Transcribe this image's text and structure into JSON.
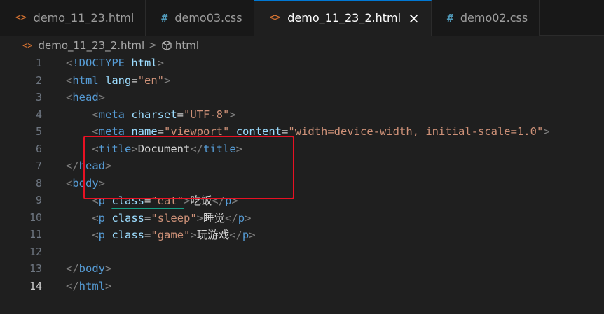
{
  "tabs": [
    {
      "label": "demo_11_23.html",
      "icon": "html-file-icon",
      "glyph": "<>",
      "active": false
    },
    {
      "label": "demo03.css",
      "icon": "css-file-icon",
      "glyph": "#",
      "active": false
    },
    {
      "label": "demo_11_23_2.html",
      "icon": "html-file-icon",
      "glyph": "<>",
      "active": true,
      "close": "×"
    },
    {
      "label": "demo02.css",
      "icon": "css-file-icon",
      "glyph": "#",
      "active": false
    }
  ],
  "breadcrumb": {
    "file_glyph": "<>",
    "file": "demo_11_23_2.html",
    "separator": ">",
    "symbol": "html"
  },
  "colors": {
    "accent": "#0078d4",
    "highlight_box": "#e81123",
    "tag": "#569cd6",
    "attribute": "#9cdcfe",
    "string": "#ce9178"
  },
  "editor": {
    "current_line": 14,
    "lines": [
      {
        "n": "1",
        "tokens": [
          [
            "br",
            "<"
          ],
          [
            "tag",
            "!DOCTYPE"
          ],
          [
            "txt",
            " "
          ],
          [
            "attr",
            "html"
          ],
          [
            "br",
            ">"
          ]
        ]
      },
      {
        "n": "2",
        "tokens": [
          [
            "br",
            "<"
          ],
          [
            "tag",
            "html"
          ],
          [
            "txt",
            " "
          ],
          [
            "attr",
            "lang"
          ],
          [
            "eq",
            "="
          ],
          [
            "str",
            "\"en\""
          ],
          [
            "br",
            ">"
          ]
        ]
      },
      {
        "n": "3",
        "tokens": [
          [
            "br",
            "<"
          ],
          [
            "tag",
            "head"
          ],
          [
            "br",
            ">"
          ]
        ]
      },
      {
        "n": "4",
        "tokens": [
          [
            "txt",
            "    "
          ],
          [
            "br",
            "<"
          ],
          [
            "tag",
            "meta"
          ],
          [
            "txt",
            " "
          ],
          [
            "attr",
            "charset"
          ],
          [
            "eq",
            "="
          ],
          [
            "str",
            "\"UTF-8\""
          ],
          [
            "br",
            ">"
          ]
        ]
      },
      {
        "n": "5",
        "tokens": [
          [
            "txt",
            "    "
          ],
          [
            "br",
            "<"
          ],
          [
            "tag",
            "meta"
          ],
          [
            "txt",
            " "
          ],
          [
            "attr",
            "name"
          ],
          [
            "eq",
            "="
          ],
          [
            "str",
            "\"viewport\""
          ],
          [
            "txt",
            " "
          ],
          [
            "attr",
            "content"
          ],
          [
            "eq",
            "="
          ],
          [
            "str",
            "\"width=device-width, initial-scale=1.0\""
          ],
          [
            "br",
            ">"
          ]
        ]
      },
      {
        "n": "6",
        "tokens": [
          [
            "txt",
            "    "
          ],
          [
            "br",
            "<"
          ],
          [
            "tag",
            "title"
          ],
          [
            "br",
            ">"
          ],
          [
            "txt",
            "Document"
          ],
          [
            "br",
            "</"
          ],
          [
            "tag",
            "title"
          ],
          [
            "br",
            ">"
          ]
        ]
      },
      {
        "n": "7",
        "tokens": [
          [
            "br",
            "</"
          ],
          [
            "tag",
            "head"
          ],
          [
            "br",
            ">"
          ]
        ]
      },
      {
        "n": "8",
        "tokens": [
          [
            "br",
            "<"
          ],
          [
            "tag",
            "body"
          ],
          [
            "br",
            ">"
          ]
        ]
      },
      {
        "n": "9",
        "tokens": [
          [
            "txt",
            "    "
          ],
          [
            "br",
            "<"
          ],
          [
            "tag",
            "p"
          ],
          [
            "txt",
            " "
          ],
          [
            "attr-sq",
            "class"
          ],
          [
            "eq-sq",
            "="
          ],
          [
            "str-sq",
            "\"eat\""
          ],
          [
            "br",
            ">"
          ],
          [
            "txt",
            "吃饭"
          ],
          [
            "br",
            "</"
          ],
          [
            "tag",
            "p"
          ],
          [
            "br",
            ">"
          ]
        ]
      },
      {
        "n": "10",
        "tokens": [
          [
            "txt",
            "    "
          ],
          [
            "br",
            "<"
          ],
          [
            "tag",
            "p"
          ],
          [
            "txt",
            " "
          ],
          [
            "attr",
            "class"
          ],
          [
            "eq",
            "="
          ],
          [
            "str",
            "\"sleep\""
          ],
          [
            "br",
            ">"
          ],
          [
            "txt",
            "睡觉"
          ],
          [
            "br",
            "</"
          ],
          [
            "tag",
            "p"
          ],
          [
            "br",
            ">"
          ]
        ]
      },
      {
        "n": "11",
        "tokens": [
          [
            "txt",
            "    "
          ],
          [
            "br",
            "<"
          ],
          [
            "tag",
            "p"
          ],
          [
            "txt",
            " "
          ],
          [
            "attr",
            "class"
          ],
          [
            "eq",
            "="
          ],
          [
            "str",
            "\"game\""
          ],
          [
            "br",
            ">"
          ],
          [
            "txt",
            "玩游戏"
          ],
          [
            "br",
            "</"
          ],
          [
            "tag",
            "p"
          ],
          [
            "br",
            ">"
          ]
        ]
      },
      {
        "n": "12",
        "tokens": []
      },
      {
        "n": "13",
        "tokens": [
          [
            "br",
            "</"
          ],
          [
            "tag",
            "body"
          ],
          [
            "br",
            ">"
          ]
        ]
      },
      {
        "n": "14",
        "tokens": [
          [
            "br",
            "</"
          ],
          [
            "tag",
            "html"
          ],
          [
            "br",
            ">"
          ]
        ]
      }
    ]
  }
}
